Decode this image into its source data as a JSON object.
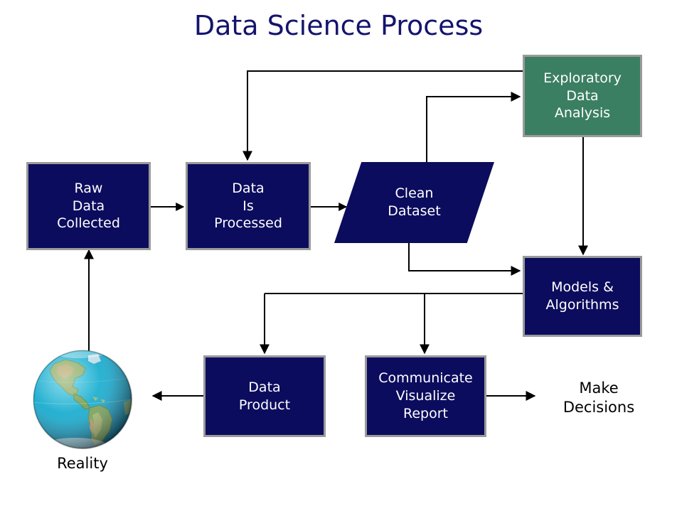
{
  "title": "Data Science Process",
  "colors": {
    "navy_fill": "#0c0c5e",
    "green_fill": "#3b7f63",
    "node_border": "#9a9a9a",
    "title_text": "#14146e",
    "node_text": "#ffffff",
    "plain_text": "#000000",
    "edge": "#000000",
    "background": "#ffffff"
  },
  "nodes": {
    "raw_data": "Raw\nData\nCollected",
    "data_processed": "Data\nIs\nProcessed",
    "clean_dataset": "Clean\nDataset",
    "exploratory": "Exploratory\nData\nAnalysis",
    "models": "Models &\nAlgorithms",
    "data_product": "Data\nProduct",
    "communicate": "Communicate\nVisualize\nReport"
  },
  "labels": {
    "make_decisions": "Make\nDecisions",
    "reality": "Reality"
  },
  "icons": {
    "globe": "globe-icon"
  },
  "edges": [
    {
      "from": "raw_data",
      "to": "data_processed"
    },
    {
      "from": "data_processed",
      "to": "clean_dataset"
    },
    {
      "from": "clean_dataset",
      "to": "exploratory"
    },
    {
      "from": "exploratory",
      "to": "data_processed"
    },
    {
      "from": "exploratory",
      "to": "models"
    },
    {
      "from": "clean_dataset",
      "to": "models"
    },
    {
      "from": "models",
      "to": "data_product"
    },
    {
      "from": "models",
      "to": "communicate"
    },
    {
      "from": "data_product",
      "to": "reality"
    },
    {
      "from": "reality",
      "to": "raw_data"
    },
    {
      "from": "communicate",
      "to": "make_decisions"
    }
  ]
}
